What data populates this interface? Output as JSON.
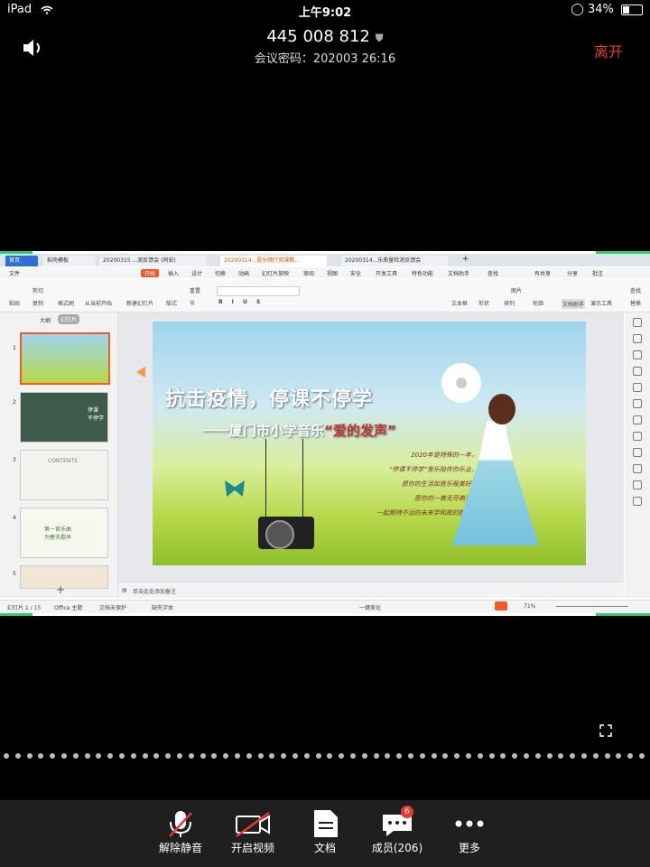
{
  "status_bar": {
    "device": "iPad",
    "time": "上午9:02",
    "battery": "34%",
    "battery_fraction": 0.34
  },
  "meeting": {
    "id": "445 008 812",
    "password_line": "会议密码：202003  26:16",
    "leave_label": "离开"
  },
  "wps": {
    "tabs": [
      "首页",
      "稻壳模板",
      "20200315 ...测反馈会 (同安)",
      "20200314...夏乐随行双课教...",
      "20200314...乐质量检测反馈会"
    ],
    "menu": [
      "文件",
      "开始",
      "插入",
      "设计",
      "切换",
      "动画",
      "幻灯片放映",
      "审阅",
      "视图",
      "安全",
      "开发工具",
      "特色功能",
      "文档助手",
      "查找"
    ],
    "menu_right": [
      "有共享",
      "分享",
      "批注"
    ],
    "ribbon": [
      "粘贴",
      "剪切",
      "复制",
      "格式刷",
      "从当前开始",
      "新建幻灯片",
      "版式",
      "节",
      "重置",
      "文本框",
      "形状",
      "排列",
      "图片",
      "轮廓",
      "文档助手",
      "演示工具",
      "查找",
      "替换"
    ],
    "panel_tabs": [
      "大纲",
      "幻灯片"
    ],
    "slide_numbers": [
      "1",
      "2",
      "3",
      "4",
      "5"
    ],
    "notes_placeholder": "单击此处添加备注",
    "status_left": [
      "幻灯片 1 / 15",
      "Office 主题",
      "文档未保护",
      "缺失字体"
    ],
    "status_mid": "一键美化",
    "zoom": "71%",
    "slide": {
      "title": "抗击疫情，停课不停学",
      "subtitle_prefix": "一一厦门市小学音乐",
      "subtitle_highlight": "“爱的发声”",
      "poem": [
        "2020年是特殊的一年，",
        "“停课不停学”音乐陪伴你乐业，",
        "愿你的生活如音乐般美好，",
        "愿你的一首无尽高亮，",
        "一起期待不远的未来学和故的胜利。"
      ],
      "thumb2_text": "停课\n不停学",
      "thumb3_text": "CONTENTS",
      "thumb4_text": "第一首乐曲\n为春天歌声"
    }
  },
  "toolbar": {
    "items": [
      {
        "label": "解除静音",
        "icon": "mic-muted-icon"
      },
      {
        "label": "开启视频",
        "icon": "video-off-icon"
      },
      {
        "label": "文档",
        "icon": "document-icon"
      },
      {
        "label": "成员(206)",
        "icon": "members-icon",
        "badge": "6"
      },
      {
        "label": "更多",
        "icon": "more-icon"
      }
    ]
  },
  "colors": {
    "accent": "#f15b2a",
    "leave": "#e53935",
    "wps_blue": "#2f6fd6",
    "share_green": "#2ecc71"
  }
}
